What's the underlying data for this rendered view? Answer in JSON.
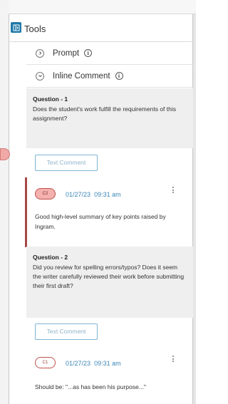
{
  "header": {
    "title": "Tools",
    "toggle_icon": "panel-collapse-icon"
  },
  "accordion": [
    {
      "label": "Prompt",
      "expanded": false,
      "icon": "chevron-right-icon",
      "info_icon": "info-icon"
    },
    {
      "label": "Inline Comment",
      "expanded": true,
      "icon": "chevron-down-icon",
      "info_icon": "info-icon"
    }
  ],
  "questions": [
    {
      "title": "Question - 1",
      "text": "Does the student's work fulfill the requirements of this assignment?",
      "text_comment_label": "Text Comment",
      "comment": {
        "chip": "C2",
        "date": "01/27/23",
        "time": "09:31 am",
        "body": "Good high-level summary of key points raised by Ingram.",
        "selected": true
      }
    },
    {
      "title": "Question - 2",
      "text": "Did you review for spelling errors/typos? Does it seem the writer carefully reviewed their work before submitting their first draft?",
      "text_comment_label": "Text Comment",
      "comment": {
        "chip": "C1",
        "date": "01/27/23",
        "time": "09:31 am",
        "body": "Should be: \"...as has been his purpose...\"",
        "selected": false
      }
    }
  ],
  "colors": {
    "accent": "#1f7aa8",
    "date_text": "#3c87b8",
    "chip_fill": "#f4b1ae",
    "chip_border": "#c0504d",
    "comment_bar": "#a64845",
    "question_bg": "#efefef"
  }
}
